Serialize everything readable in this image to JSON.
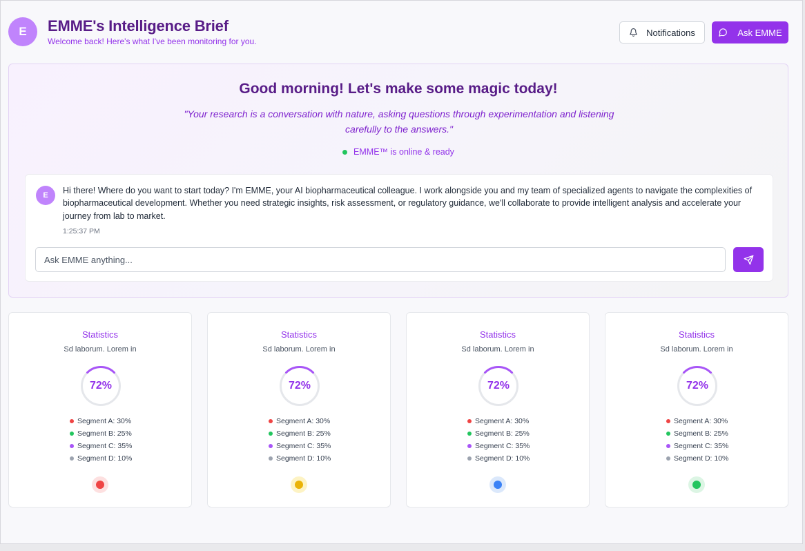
{
  "header": {
    "logo_letter": "E",
    "title": "EMME's Intelligence Brief",
    "subtitle": "Welcome back! Here's what I've been monitoring for you.",
    "notifications_label": "Notifications",
    "notifications_icon": "bell-icon",
    "ask_label": "Ask EMME",
    "ask_icon": "message-circle-icon"
  },
  "hero": {
    "greeting": "Good morning! Let's make some magic today!",
    "quote": "\"Your research is a conversation with nature, asking questions through experimentation and listening carefully to the answers.\"",
    "status_text": "EMME™ is online & ready",
    "status_color": "#22c55e"
  },
  "chat": {
    "avatar_letter": "E",
    "message": "Hi there! Where do you want to start today? I'm EMME, your AI biopharmaceutical colleague. I work alongside you and my team of specialized agents to navigate the complexities of biopharmaceutical development. Whether you need strategic insights, risk assessment, or regulatory guidance, we'll collaborate to provide intelligent analysis and accelerate your journey from lab to market.",
    "timestamp": "1:25:37 PM",
    "input_placeholder": "Ask EMME anything...",
    "send_icon": "send-icon"
  },
  "colors": {
    "accent": "#9333ea",
    "brand_dark": "#581c87",
    "segment_a": "#ef4444",
    "segment_b": "#22c55e",
    "segment_c": "#a855f7",
    "segment_d": "#9ca3af"
  },
  "stat_cards": [
    {
      "title": "Statistics",
      "subtitle": "Sd laborum. Lorem in",
      "percent_label": "72%",
      "percent_value": 72,
      "segments": [
        "Segment A: 30%",
        "Segment B: 25%",
        "Segment C: 35%",
        "Segment D: 10%"
      ],
      "indicator_color": "#ef4444",
      "indicator_bg": "#fde0e0"
    },
    {
      "title": "Statistics",
      "subtitle": "Sd laborum. Lorem in",
      "percent_label": "72%",
      "percent_value": 72,
      "segments": [
        "Segment A: 30%",
        "Segment B: 25%",
        "Segment C: 35%",
        "Segment D: 10%"
      ],
      "indicator_color": "#eab308",
      "indicator_bg": "#fdf3c4"
    },
    {
      "title": "Statistics",
      "subtitle": "Sd laborum. Lorem in",
      "percent_label": "72%",
      "percent_value": 72,
      "segments": [
        "Segment A: 30%",
        "Segment B: 25%",
        "Segment C: 35%",
        "Segment D: 10%"
      ],
      "indicator_color": "#3b82f6",
      "indicator_bg": "#dbe8fb"
    },
    {
      "title": "Statistics",
      "subtitle": "Sd laborum. Lorem in",
      "percent_label": "72%",
      "percent_value": 72,
      "segments": [
        "Segment A: 30%",
        "Segment B: 25%",
        "Segment C: 35%",
        "Segment D: 10%"
      ],
      "indicator_color": "#22c55e",
      "indicator_bg": "#dcf5e4"
    }
  ]
}
